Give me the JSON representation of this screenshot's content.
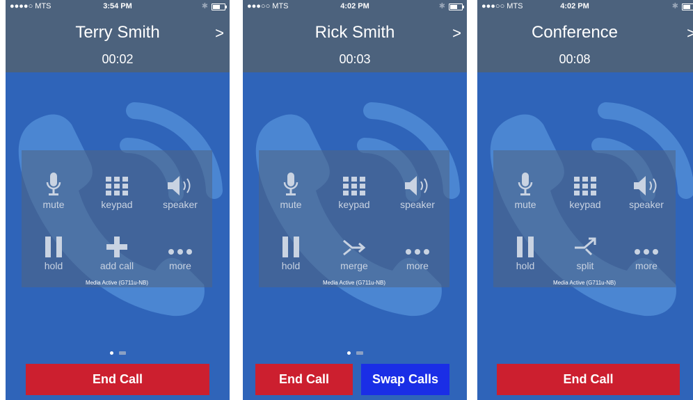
{
  "colors": {
    "header": "#4c627d",
    "background": "#2f64b9",
    "end_call": "#cc1f2f",
    "swap_calls": "#1a2ee6"
  },
  "screens": [
    {
      "status": {
        "carrier": "●●●●○ MTS",
        "time": "3:54 PM"
      },
      "caller": "Terry Smith",
      "duration": "00:02",
      "controls": {
        "mute": "mute",
        "keypad": "keypad",
        "speaker": "speaker",
        "hold": "hold",
        "middle": "add call",
        "more": "more"
      },
      "codec": "Media Active (G711u-NB)",
      "end_call": "End Call"
    },
    {
      "status": {
        "carrier": "●●●○○ MTS",
        "time": "4:02 PM"
      },
      "caller": "Rick Smith",
      "duration": "00:03",
      "controls": {
        "mute": "mute",
        "keypad": "keypad",
        "speaker": "speaker",
        "hold": "hold",
        "middle": "merge",
        "more": "more"
      },
      "codec": "Media Active (G711u-NB)",
      "end_call": "End Call",
      "swap_calls": "Swap Calls"
    },
    {
      "status": {
        "carrier": "●●●○○ MTS",
        "time": "4:02 PM"
      },
      "caller": "Conference",
      "duration": "00:08",
      "controls": {
        "mute": "mute",
        "keypad": "keypad",
        "speaker": "speaker",
        "hold": "hold",
        "middle": "split",
        "more": "more"
      },
      "codec": "Media Active (G711u-NB)",
      "end_call": "End Call"
    }
  ]
}
